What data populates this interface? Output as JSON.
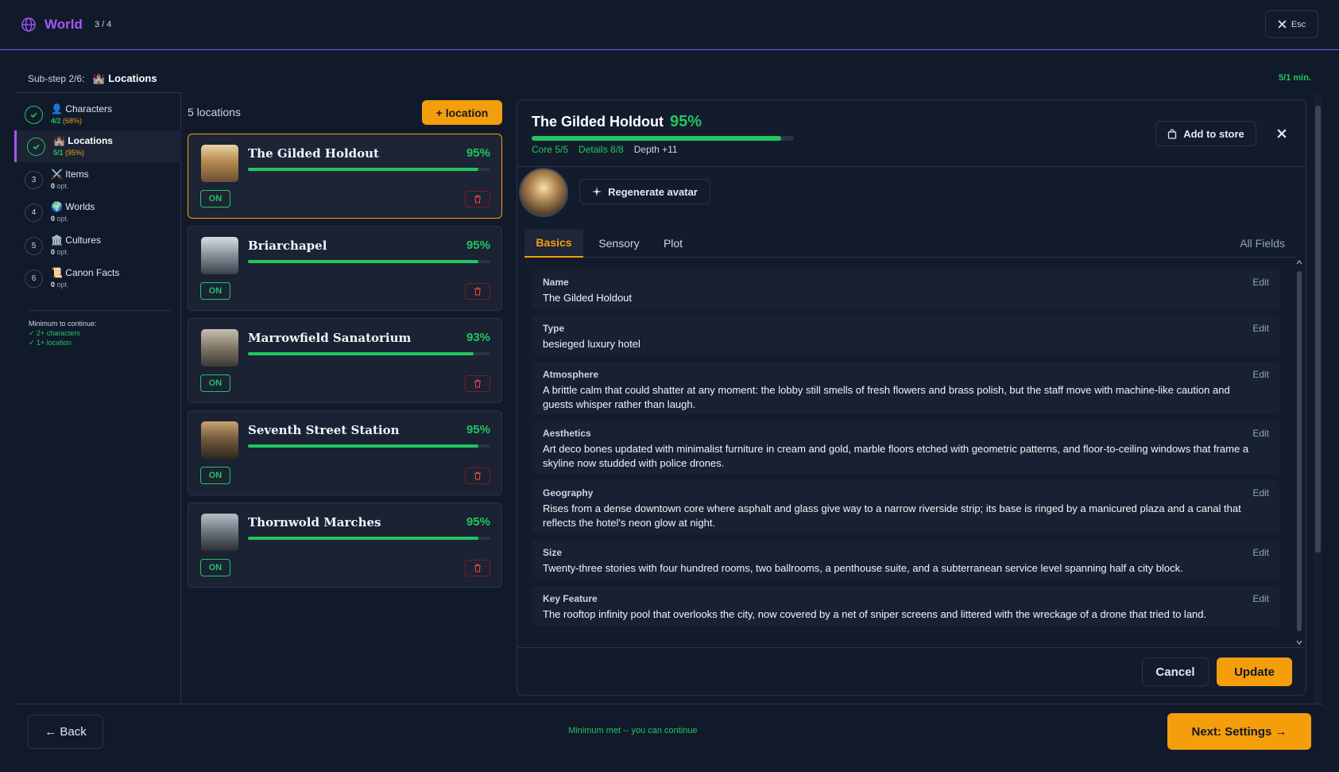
{
  "header": {
    "title": "World",
    "step": "3 / 4",
    "close_label": "Esc"
  },
  "substep": {
    "label": "Sub-step 2/6:",
    "current": "Locations",
    "current_icon": "🏰",
    "min_status": "5/1 min."
  },
  "sidebar": {
    "items": [
      {
        "label": "Characters",
        "icon": "👤",
        "num": "",
        "done": true,
        "count": "4/2",
        "note": "(68%)"
      },
      {
        "label": "Locations",
        "icon": "🏰",
        "num": "",
        "done": true,
        "count": "5/1",
        "note": "(95%)"
      },
      {
        "label": "Items",
        "icon": "⚔️",
        "num": "3",
        "done": false,
        "count": "0",
        "note": "opt."
      },
      {
        "label": "Worlds",
        "icon": "🌍",
        "num": "4",
        "done": false,
        "count": "0",
        "note": "opt."
      },
      {
        "label": "Cultures",
        "icon": "🏛️",
        "num": "5",
        "done": false,
        "count": "0",
        "note": "opt."
      },
      {
        "label": "Canon Facts",
        "icon": "📜",
        "num": "6",
        "done": false,
        "count": "0",
        "note": "opt."
      }
    ],
    "minimum": {
      "heading": "Minimum to continue:",
      "req1": "✓ 2+ characters",
      "req2": "✓ 1+ location"
    }
  },
  "list": {
    "count_label": "5 locations",
    "add_label": "+ location",
    "on_label": "ON",
    "cards": [
      {
        "name": "The Gilded Holdout",
        "pct": "95%",
        "progress": 0.95
      },
      {
        "name": "Briarchapel",
        "pct": "95%",
        "progress": 0.95
      },
      {
        "name": "Marrowfield Sanatorium",
        "pct": "93%",
        "progress": 0.93
      },
      {
        "name": "Seventh Street Station",
        "pct": "95%",
        "progress": 0.95
      },
      {
        "name": "Thornwold Marches",
        "pct": "95%",
        "progress": 0.95
      }
    ]
  },
  "detail": {
    "title": "The Gilded Holdout",
    "pct": "95%",
    "progress": 0.95,
    "core": "Core 5/5",
    "details": "Details 8/8",
    "depth": "Depth +11",
    "add_store": "Add to store",
    "regen": "Regenerate avatar",
    "tabs": [
      "Basics",
      "Sensory",
      "Plot"
    ],
    "all_fields": "All Fields",
    "edit_label": "Edit",
    "fields": [
      {
        "label": "Name",
        "value": "The Gilded Holdout"
      },
      {
        "label": "Type",
        "value": "besieged luxury hotel"
      },
      {
        "label": "Atmosphere",
        "value": "A brittle calm that could shatter at any moment: the lobby still smells of fresh flowers and brass polish, but the staff move with machine-like caution and guests whisper rather than laugh."
      },
      {
        "label": "Aesthetics",
        "value": "Art deco bones updated with minimalist furniture in cream and gold, marble floors etched with geometric patterns, and floor-to-ceiling windows that frame a skyline now studded with police drones."
      },
      {
        "label": "Geography",
        "value": "Rises from a dense downtown core where asphalt and glass give way to a narrow riverside strip; its base is ringed by a manicured plaza and a canal that reflects the hotel's neon glow at night."
      },
      {
        "label": "Size",
        "value": "Twenty-three stories with four hundred rooms, two ballrooms, a penthouse suite, and a subterranean service level spanning half a city block."
      },
      {
        "label": "Key Feature",
        "value": "The rooftop infinity pool that overlooks the city, now covered by a net of sniper screens and littered with the wreckage of a drone that tried to land."
      }
    ],
    "cancel": "Cancel",
    "update": "Update"
  },
  "footer": {
    "back": "← Back",
    "status": "Minimum met -- you can continue",
    "next": "Next: Settings →"
  },
  "colors": {
    "accent": "#f59e0b",
    "success": "#22c55e",
    "brand": "#a855f7",
    "danger": "#ef4444",
    "bg": "#111a2b"
  }
}
